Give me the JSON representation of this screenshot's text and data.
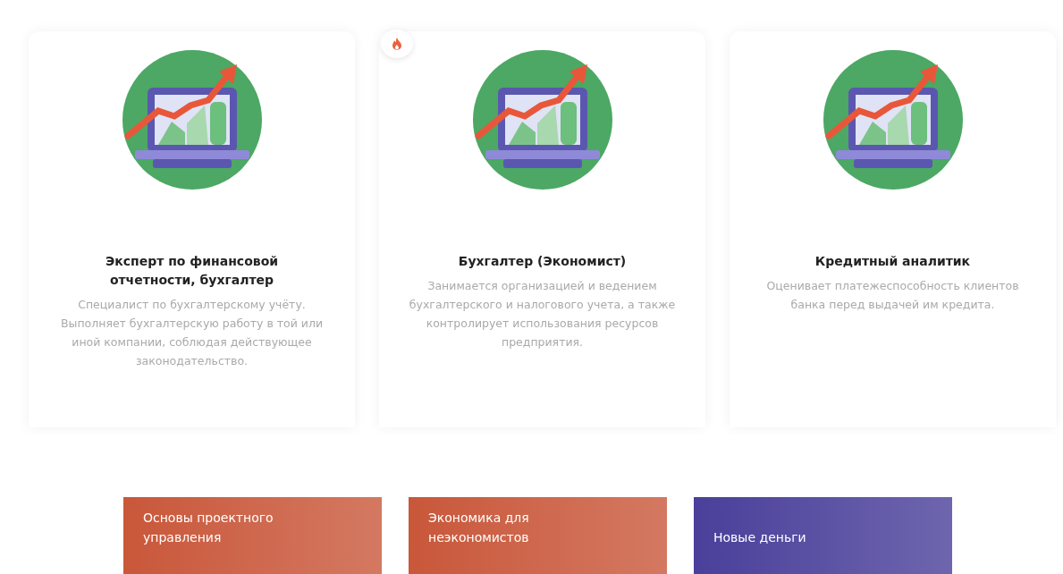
{
  "professions": [
    {
      "title": "Эксперт по финансовой отчетности, бухгалтер",
      "description": "Специалист по бухгалтерскому учёту. Выполняет бухгалтерскую работу в той или иной компании, соблюдая действующее законодательство.",
      "hot": false
    },
    {
      "title": "Бухгалтер (Экономист)",
      "description": "Занимается организацией и ведением бухгалтерского и налогового учета, а также контролирует использования ресурсов предприятия.",
      "hot": true
    },
    {
      "title": "Кредитный аналитик",
      "description": "Оценивает платежеспособность клиентов банка перед выдачей им кредита.",
      "hot": false
    }
  ],
  "courses": [
    {
      "title": "Основы проектного управления",
      "color": "#c9573a"
    },
    {
      "title": "Экономика для неэкономистов",
      "color": "#c9573a"
    },
    {
      "title": "Новые деньги",
      "color": "#4a3f9a"
    }
  ]
}
